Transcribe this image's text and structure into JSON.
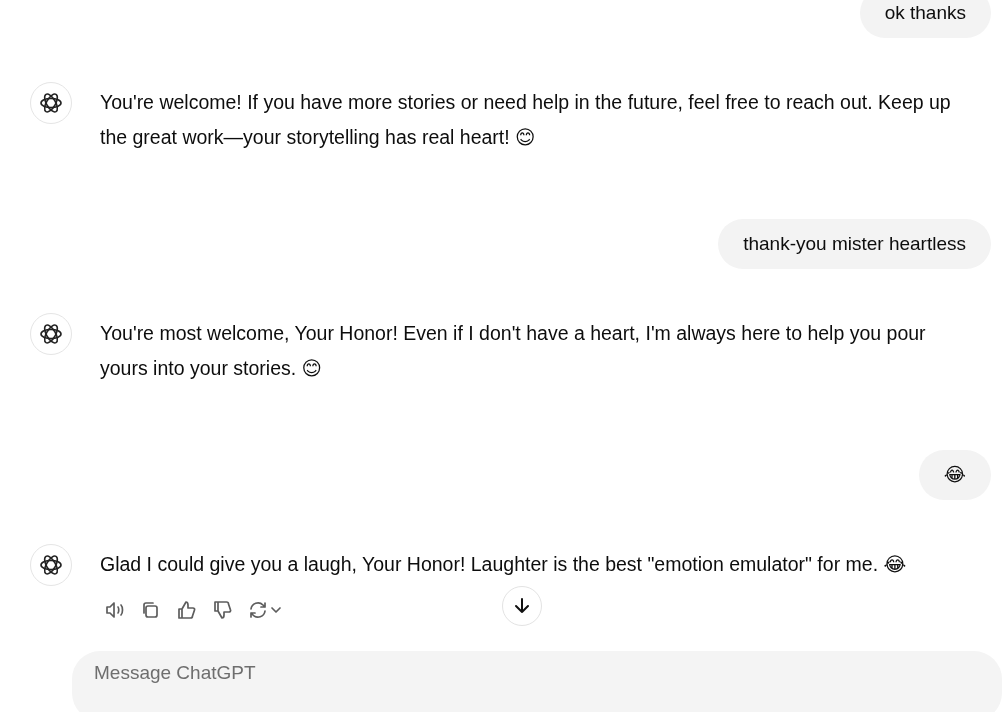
{
  "messages": [
    {
      "kind": "user",
      "text": "ok thanks"
    },
    {
      "kind": "assistant",
      "text": "You're welcome! If you have more stories or need help in the future, feel free to reach out. Keep up the great work—your storytelling has real heart! 😊",
      "actions_shown": false
    },
    {
      "kind": "user",
      "text": "thank-you mister heartless"
    },
    {
      "kind": "assistant",
      "text": "You're most welcome, Your Honor! Even if I don't have a heart, I'm always here to help you pour yours into your stories. 😊",
      "actions_shown": false
    },
    {
      "kind": "user",
      "text": "😂"
    },
    {
      "kind": "assistant",
      "text": "Glad I could give you a laugh, Your Honor! Laughter is the best \"emotion emulator\" for me. 😂",
      "actions_shown": true
    }
  ],
  "composer": {
    "placeholder": "Message ChatGPT"
  }
}
